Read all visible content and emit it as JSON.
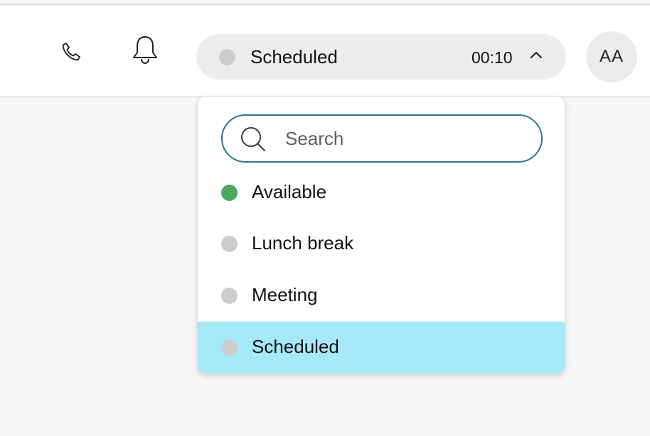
{
  "header": {
    "call_icon": "phone-icon",
    "notification_icon": "bell-icon",
    "status": {
      "label": "Scheduled",
      "timer": "00:10",
      "dot_color": "#cccccc",
      "chevron_icon": "chevron-up-icon"
    },
    "avatar": {
      "initials": "AA"
    }
  },
  "dropdown": {
    "search": {
      "placeholder": "Search",
      "value": "",
      "icon": "search-icon"
    },
    "options": [
      {
        "label": "Available",
        "dot_color": "#4caa5e",
        "selected": false
      },
      {
        "label": "Lunch break",
        "dot_color": "#cccccc",
        "selected": false
      },
      {
        "label": "Meeting",
        "dot_color": "#cccccc",
        "selected": false
      },
      {
        "label": "Scheduled",
        "dot_color": "#cccccc",
        "selected": true
      }
    ],
    "selected_bg_color": "#a6e9f9"
  }
}
